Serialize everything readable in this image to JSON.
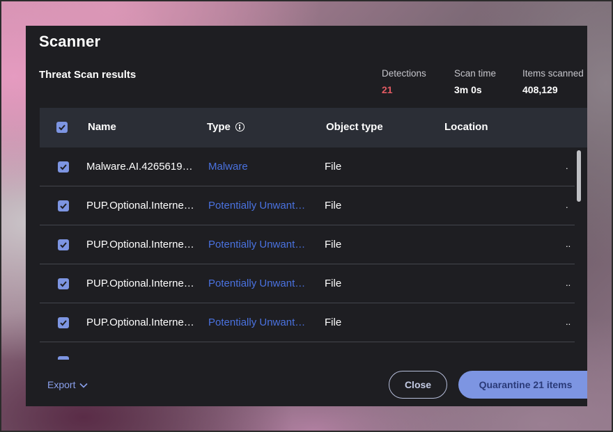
{
  "app": {
    "title": "Scanner"
  },
  "results": {
    "title": "Threat Scan results"
  },
  "stats": [
    {
      "label": "Detections",
      "value": "21",
      "color": "#e35b63"
    },
    {
      "label": "Scan time",
      "value": "3m 0s"
    },
    {
      "label": "Items scanned",
      "value": "408,129"
    }
  ],
  "table": {
    "columns": {
      "name": "Name",
      "type": "Type",
      "object_type": "Object type",
      "location": "Location"
    },
    "rows": [
      {
        "name": "Malware.AI.4265619…",
        "type": "Malware",
        "object_type": "File",
        "location": "."
      },
      {
        "name": "PUP.Optional.Interne…",
        "type": "Potentially Unwant…",
        "object_type": "File",
        "location": "."
      },
      {
        "name": "PUP.Optional.Interne…",
        "type": "Potentially Unwant…",
        "object_type": "File",
        "location": ".."
      },
      {
        "name": "PUP.Optional.Interne…",
        "type": "Potentially Unwant…",
        "object_type": "File",
        "location": ".."
      },
      {
        "name": "PUP.Optional.Interne…",
        "type": "Potentially Unwant…",
        "object_type": "File",
        "location": ".."
      }
    ]
  },
  "footer": {
    "export_label": "Export",
    "close_label": "Close",
    "quarantine_label": "Quarantine 21 items"
  },
  "colors": {
    "accent": "#7d95e2",
    "link": "#4a72e0",
    "danger": "#e35b63",
    "dialog_bg": "#1e1e22",
    "header_bg": "#2b2e36"
  }
}
